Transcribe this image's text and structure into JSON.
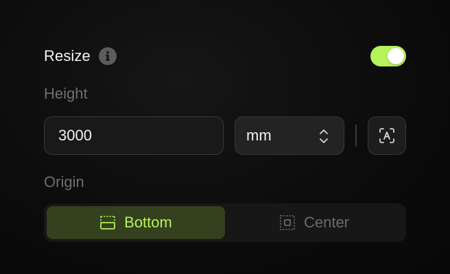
{
  "resize": {
    "label": "Resize",
    "enabled": true,
    "info_icon": "info-icon"
  },
  "height": {
    "label": "Height",
    "value": "3000",
    "unit": "mm",
    "unit_icon": "chevron-up-down-icon",
    "auto_icon": "auto-size-icon"
  },
  "origin": {
    "label": "Origin",
    "options": [
      {
        "label": "Bottom",
        "icon": "align-bottom-icon",
        "selected": true
      },
      {
        "label": "Center",
        "icon": "align-center-icon",
        "selected": false
      }
    ]
  },
  "colors": {
    "accent": "#b6f25a",
    "accent_bg": "#34401e",
    "background": "#0d0d0d",
    "muted_text": "#6f6f6f"
  }
}
